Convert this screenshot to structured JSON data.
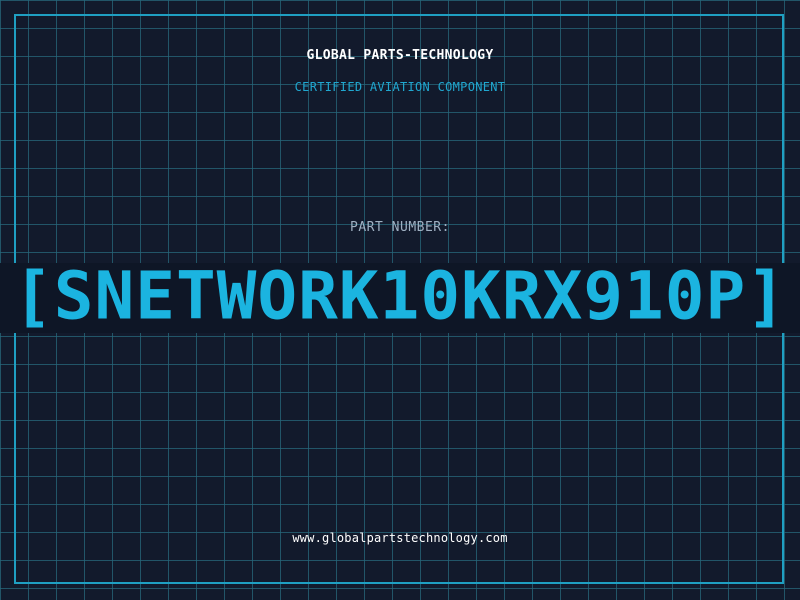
{
  "header": {
    "company_name": "GLOBAL PARTS-TECHNOLOGY",
    "subtitle": "CERTIFIED AVIATION COMPONENT"
  },
  "part": {
    "label": "PART NUMBER:",
    "number": "[SNETWORK10KRX910P]"
  },
  "footer": {
    "website": "www.globalpartstechnology.com"
  },
  "colors": {
    "background": "#121a2c",
    "grid": "#26687c",
    "frame": "#1f9fc2",
    "accent": "#1bb4e0"
  }
}
